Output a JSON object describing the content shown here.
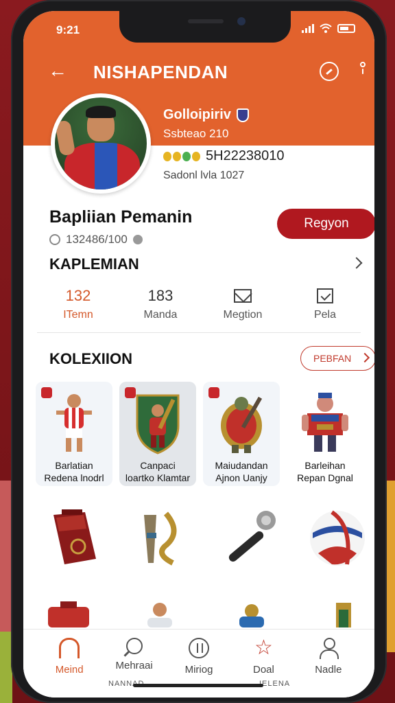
{
  "status_bar": {
    "time": "9:21"
  },
  "header": {
    "title": "NISHAPENDAN",
    "profile": {
      "name": "Golloipiriv",
      "sub": "Ssbteao 210",
      "coins_value": "5H22238010",
      "since": "Sadonl lvla 1027"
    }
  },
  "player": {
    "name": "Bapliian Pemanin",
    "id": "132486/100",
    "action_label": "Regyon"
  },
  "stats_section": {
    "title": "KAPLEMIAN",
    "tabs": [
      {
        "value": "132",
        "label": "ITemn"
      },
      {
        "value": "183",
        "label": "Manda"
      },
      {
        "value": "",
        "label": "Megtion"
      },
      {
        "value": "",
        "label": "Pela"
      }
    ]
  },
  "collection": {
    "title": "KOLEXIION",
    "see_all_label": "PEBFAN",
    "cards": [
      {
        "line1": "Barlatian",
        "line2": "Redena lnodrl"
      },
      {
        "line1": "Canpaci",
        "line2": "loartko Klamtar"
      },
      {
        "line1": "Maiudandan",
        "line2": "Ajnon Uanjy"
      },
      {
        "line1": "Barleihan",
        "line2": "Repan Dgnal"
      }
    ]
  },
  "bottom_nav": {
    "items": [
      {
        "label": "Meind"
      },
      {
        "label": "Mehraai"
      },
      {
        "label": "Miriog"
      },
      {
        "label": "Doal"
      },
      {
        "label": "Nadle"
      }
    ],
    "captions": [
      "NANNAD",
      "IELENA"
    ]
  },
  "colors": {
    "header": "#e2622d",
    "primary_button": "#b0181f",
    "active_tab": "#d4582a"
  }
}
